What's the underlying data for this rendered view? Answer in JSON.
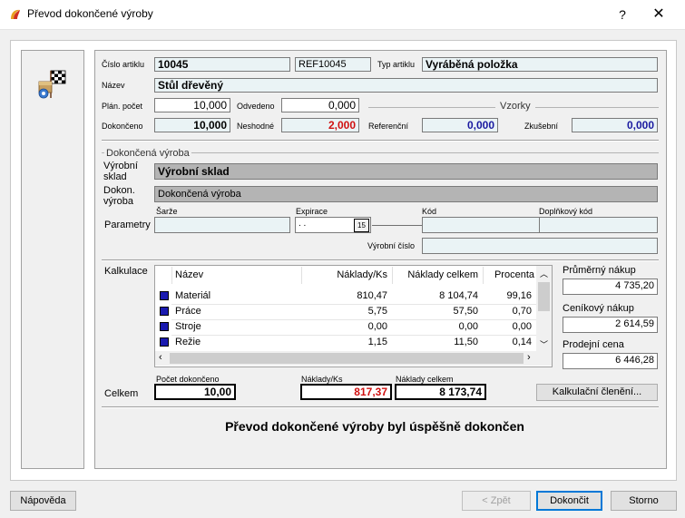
{
  "window": {
    "title": "Převod dokončené výroby",
    "help": "?",
    "close": "✕"
  },
  "article": {
    "cislo_label": "Číslo artiklu",
    "cislo": "10045",
    "ref": "REF10045",
    "typ_label": "Typ artiklu",
    "typ": "Vyráběná položka",
    "nazev_label": "Název",
    "nazev": "Stůl dřevěný",
    "plan_label": "Plán. počet",
    "plan": "10,000",
    "odvedeno_label": "Odvedeno",
    "odvedeno": "0,000",
    "dokonceno_label": "Dokončeno",
    "dokonceno": "10,000",
    "neshodne_label": "Neshodné",
    "neshodne": "2,000",
    "vzorky_label": "Vzorky",
    "referencni_label": "Referenční",
    "referencni": "0,000",
    "zkusebni_label": "Zkušební",
    "zkusebni": "0,000"
  },
  "hotova": {
    "group_label": "Dokončená výroba",
    "sklad_label": "Výrobní sklad",
    "sklad": "Výrobní sklad",
    "dokon_label": "Dokon. výroba",
    "dokon": "Dokončená výroba",
    "parametry_label": "Parametry",
    "sarze_label": "Šarže",
    "sarze": "",
    "expirace_label": "Expirace",
    "expirace": " .  .",
    "kod_label": "Kód",
    "kod": "",
    "doplnkovy_label": "Doplňkový kód",
    "doplnkovy": "",
    "vyrobni_cislo_label": "Výrobní číslo",
    "vyrobni_cislo": ""
  },
  "kalkulace": {
    "label": "Kalkulace",
    "headers": [
      "Název",
      "Náklady/Ks",
      "Náklady celkem",
      "Procenta"
    ],
    "rows": [
      {
        "nazev": "Materiál",
        "ks": "810,47",
        "celkem": "8 104,74",
        "procenta": "99,16"
      },
      {
        "nazev": "Práce",
        "ks": "5,75",
        "celkem": "57,50",
        "procenta": "0,70"
      },
      {
        "nazev": "Stroje",
        "ks": "0,00",
        "celkem": "0,00",
        "procenta": "0,00"
      },
      {
        "nazev": "Režie",
        "ks": "1,15",
        "celkem": "11,50",
        "procenta": "0,14"
      }
    ],
    "prumerny_label": "Průměrný nákup",
    "prumerny": "4 735,20",
    "cenikovy_label": "Ceníkový nákup",
    "cenikovy": "2 614,59",
    "prodejni_label": "Prodejní cena",
    "prodejni": "6 446,28"
  },
  "celkem": {
    "label": "Celkem",
    "pocet_label": "Počet dokončeno",
    "pocet": "10,00",
    "ks_label": "Náklady/Ks",
    "ks": "817,37",
    "celkem_label": "Náklady celkem",
    "celkem": "8 173,74",
    "cleneni_button": "Kalkulační členění..."
  },
  "message": "Převod dokončené výroby byl úspěšně dokončen",
  "buttons": {
    "napoveda": "Nápověda",
    "zpet": "< Zpět",
    "dokoncit": "Dokončit",
    "storno": "Storno"
  }
}
